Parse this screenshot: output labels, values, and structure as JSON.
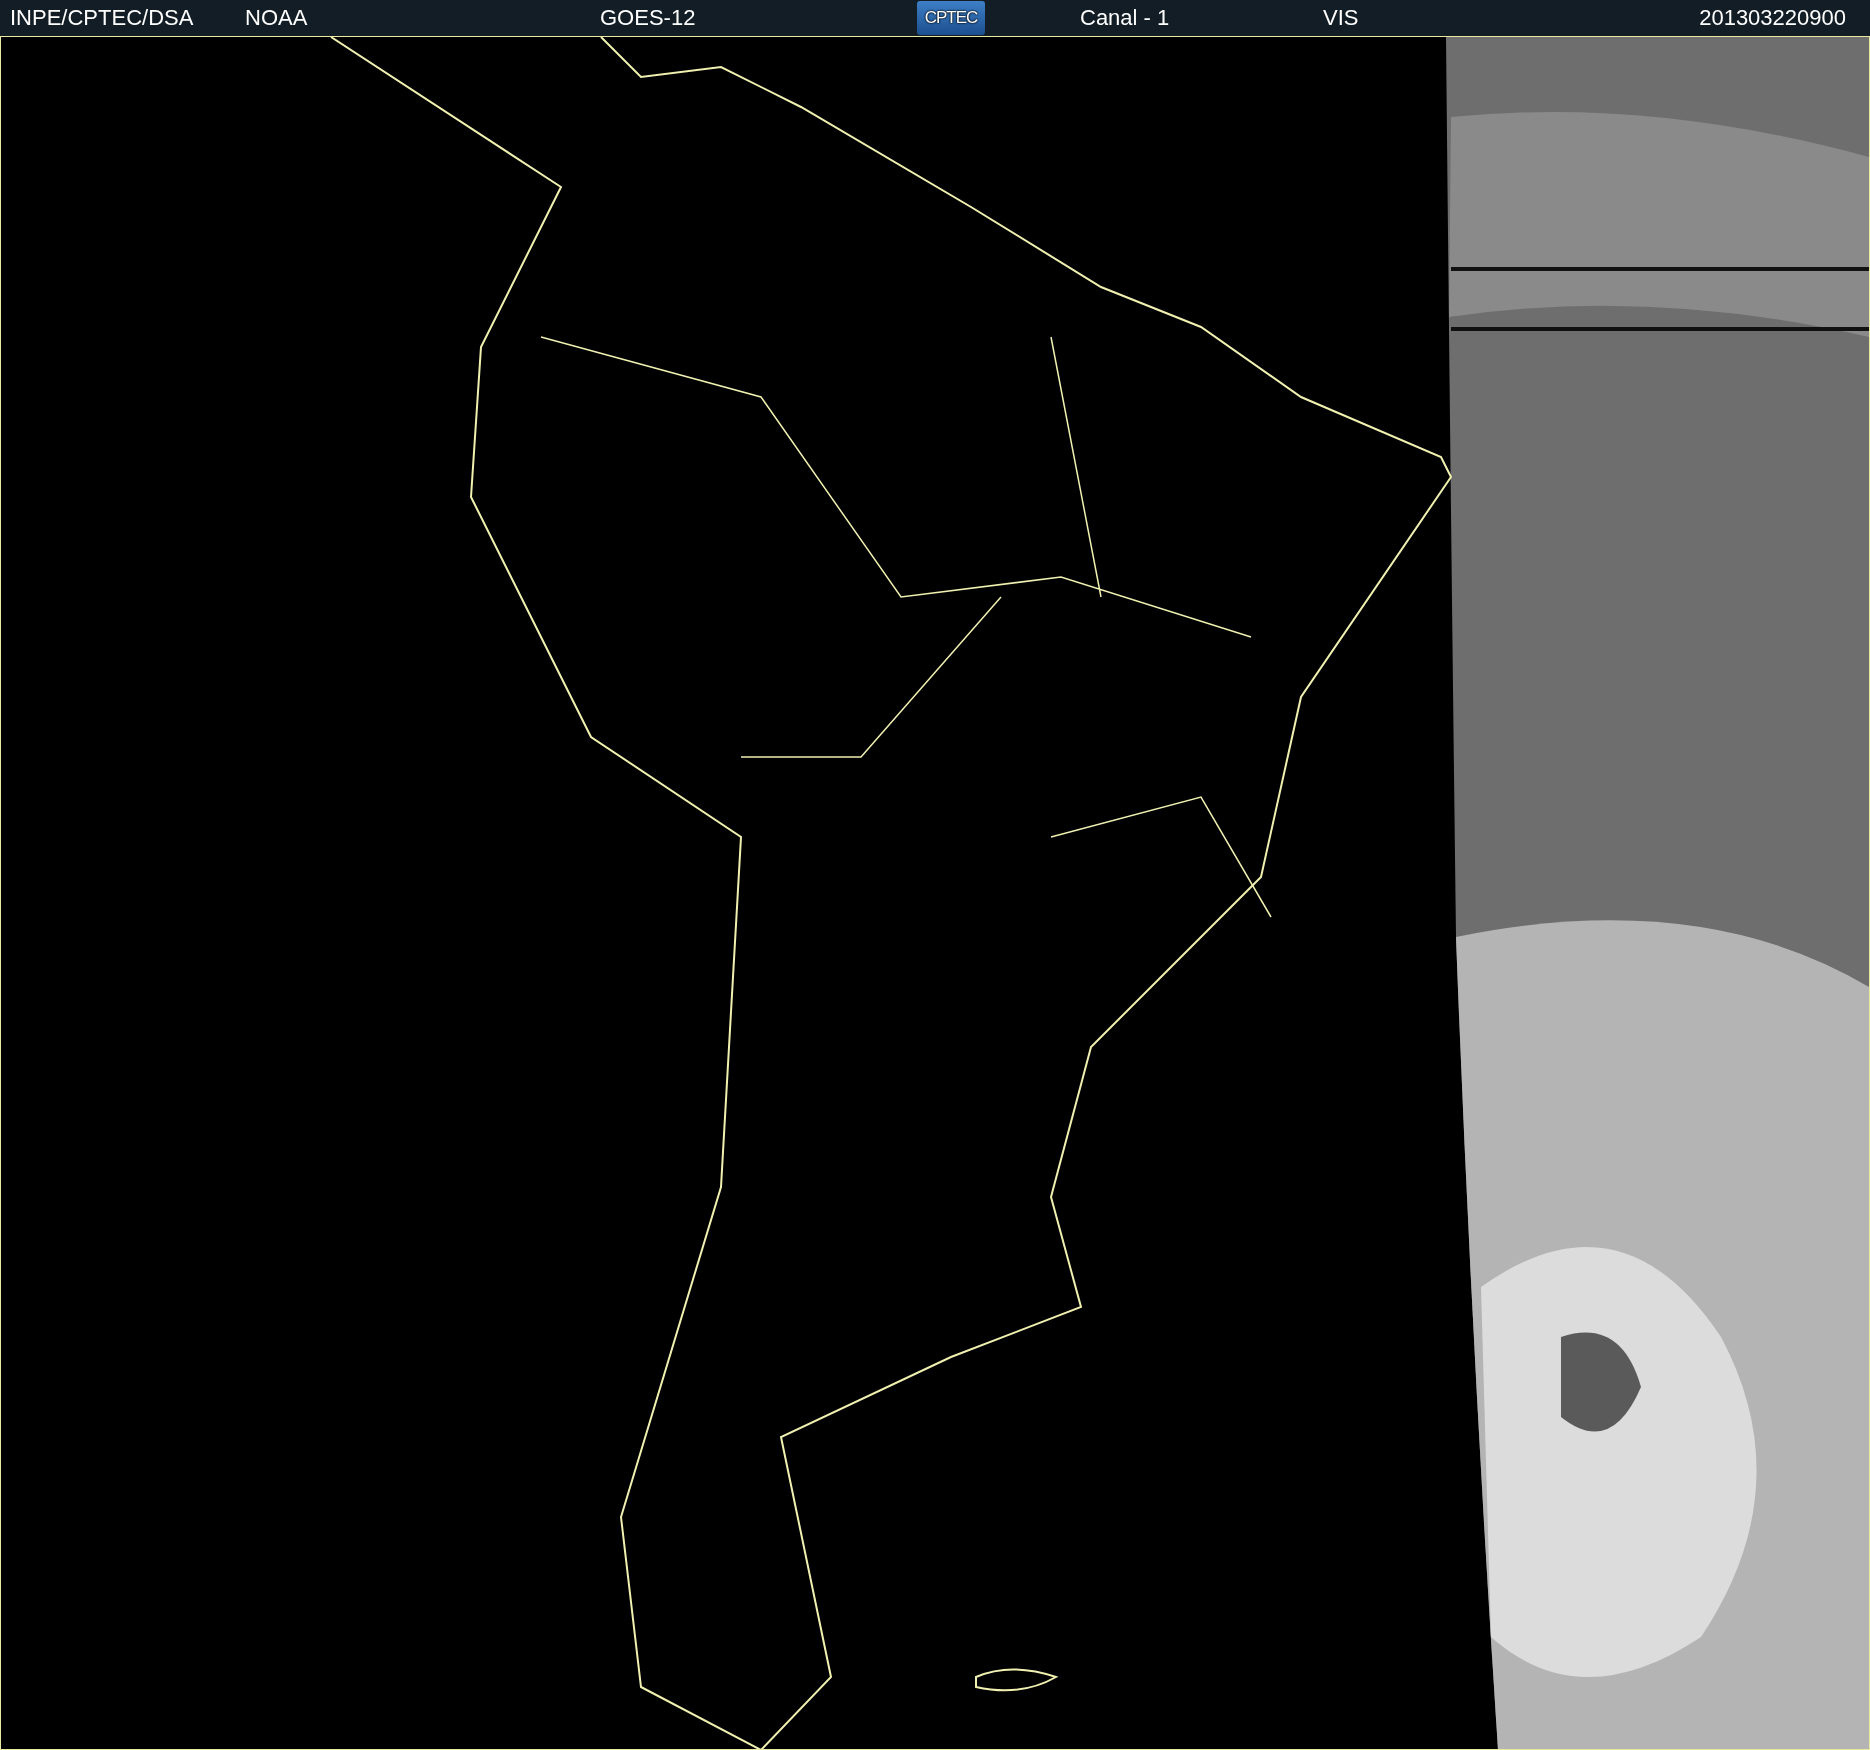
{
  "header": {
    "source": "INPE/CPTEC/DSA",
    "agency": "NOAA",
    "satellite": "GOES-12",
    "logo_text": "CPTEC",
    "channel": "Canal - 1",
    "band": "VIS",
    "timestamp": "201303220900"
  }
}
